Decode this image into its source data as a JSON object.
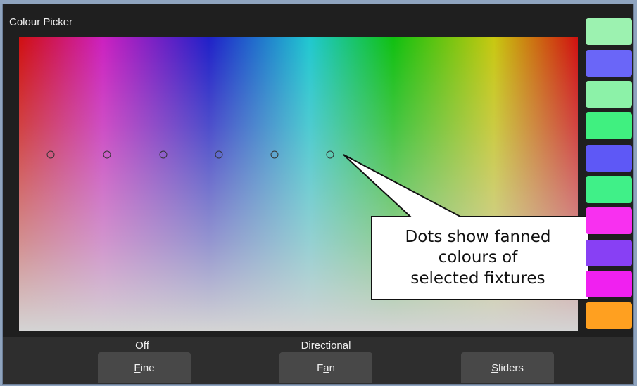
{
  "window": {
    "title": "Colour Picker"
  },
  "picker": {
    "dots": [
      {
        "name": "fixture-dot-1"
      },
      {
        "name": "fixture-dot-2"
      },
      {
        "name": "fixture-dot-3"
      },
      {
        "name": "fixture-dot-4"
      },
      {
        "name": "fixture-dot-5"
      },
      {
        "name": "fixture-dot-6"
      }
    ],
    "callout_lines": [
      "Dots show fanned",
      "colours of",
      "selected fixtures"
    ]
  },
  "palette": [
    {
      "color": "#9cf2b0"
    },
    {
      "color": "#6a66f8"
    },
    {
      "color": "#8cf2a8"
    },
    {
      "color": "#40f080"
    },
    {
      "color": "#5e58f6"
    },
    {
      "color": "#40f088"
    },
    {
      "color": "#f830f0"
    },
    {
      "color": "#8840f4"
    },
    {
      "color": "#f020f0"
    },
    {
      "color": "#ffa020"
    }
  ],
  "bottom_bar": {
    "fine": {
      "status": "Off",
      "label_pre": "",
      "label_key": "F",
      "label_post": "ine"
    },
    "fan": {
      "status": "Directional",
      "label_pre": "F",
      "label_key": "a",
      "label_post": "n"
    },
    "sliders": {
      "status": "",
      "label_pre": "",
      "label_key": "S",
      "label_post": "liders"
    }
  }
}
